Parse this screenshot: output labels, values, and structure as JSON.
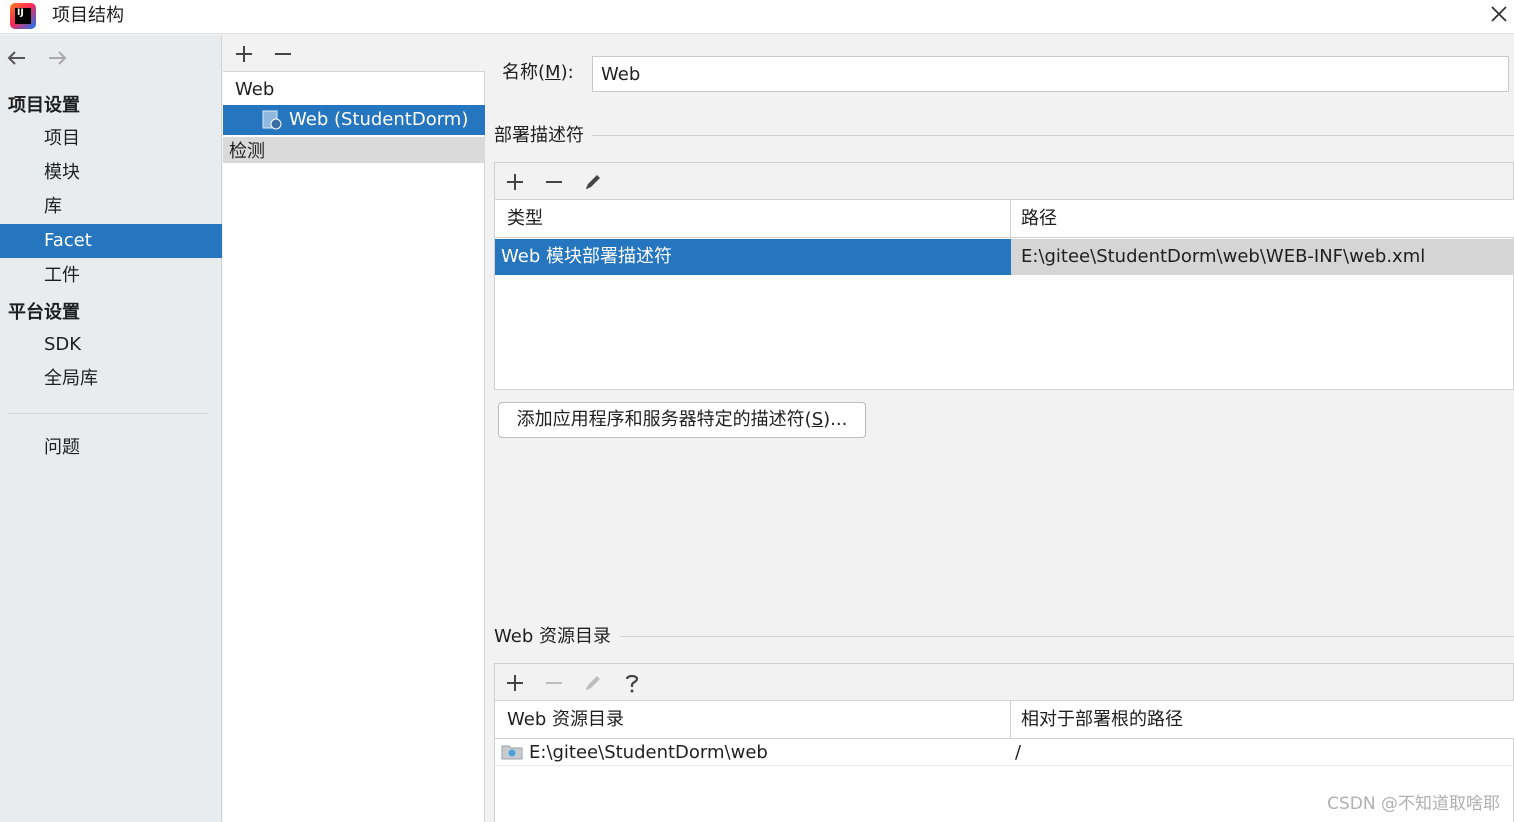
{
  "window": {
    "title": "项目结构",
    "logo_text": "IJ"
  },
  "nav": {
    "back_icon": "arrow-left-icon",
    "forward_icon": "arrow-right-icon",
    "project_settings_header": "项目设置",
    "project_items": [
      "项目",
      "模块",
      "库",
      "Facet",
      "工件"
    ],
    "platform_settings_header": "平台设置",
    "platform_items": [
      "SDK",
      "全局库"
    ],
    "problems": "问题",
    "selected": "Facet"
  },
  "facets": {
    "toolbar": [
      "add-icon",
      "remove-icon"
    ],
    "group": "Web",
    "selected_item": "Web (StudentDorm)",
    "detection": "检测"
  },
  "detail": {
    "name_label": "名称",
    "name_mnemonic": "M",
    "name_value": "Web",
    "descriptors": {
      "title": "部署描述符",
      "toolbar": [
        "add-icon",
        "remove-icon",
        "edit-icon"
      ],
      "columns": [
        "类型",
        "路径"
      ],
      "rows": [
        {
          "type": "Web 模块部署描述符",
          "path": "E:\\gitee\\StudentDorm\\web\\WEB-INF\\web.xml"
        }
      ],
      "add_button_prefix": "添加应用程序和服务器特定的描述符(",
      "add_button_mnemonic": "S",
      "add_button_suffix": ")..."
    },
    "resources": {
      "title": "Web 资源目录",
      "toolbar": [
        "add-icon",
        "remove-icon",
        "edit-icon",
        "help-icon"
      ],
      "columns": [
        "Web 资源目录",
        "相对于部署根的路径"
      ],
      "rows": [
        {
          "dir": "E:\\gitee\\StudentDorm\\web",
          "relative": "/"
        }
      ]
    }
  },
  "watermark": "CSDN @不知道取啥耶",
  "colors": {
    "selection": "#2675bf",
    "panel_bg": "#f2f2f2",
    "nav_bg": "#e9ecef"
  }
}
